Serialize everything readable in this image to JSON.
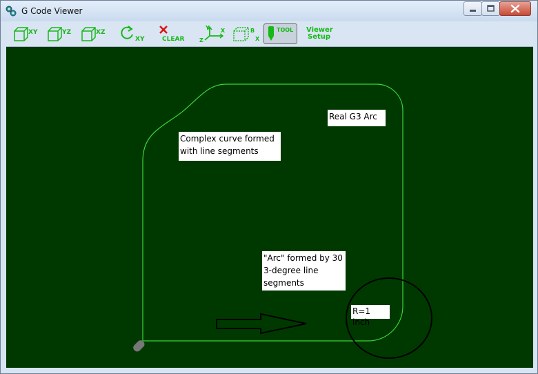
{
  "window": {
    "title": "G Code Viewer",
    "icon": "app-gear-icon"
  },
  "toolbar": {
    "view_xy": "XY",
    "view_yz": "YZ",
    "view_xz": "XZ",
    "rotate_xy": "XY",
    "clear": "CLEAR",
    "axes_y": "Y",
    "axes_x": "X",
    "axes_z": "Z",
    "box_b": "B",
    "box_x": "X",
    "tool": "TOOL",
    "viewer_setup_line1": "Viewer",
    "viewer_setup_line2": "Setup"
  },
  "annotations": {
    "real_arc": "Real G3 Arc",
    "complex_curve": "Complex curve formed\nwith line segments",
    "segmented_arc": "\"Arc\" formed by 30\n3-degree line\nsegments",
    "radius": "R=1 inch"
  },
  "colors": {
    "canvas_bg": "#003900",
    "toolpath": "#3ad43a",
    "toolbar_icon": "#16b816",
    "clear_x": "#e01010"
  }
}
